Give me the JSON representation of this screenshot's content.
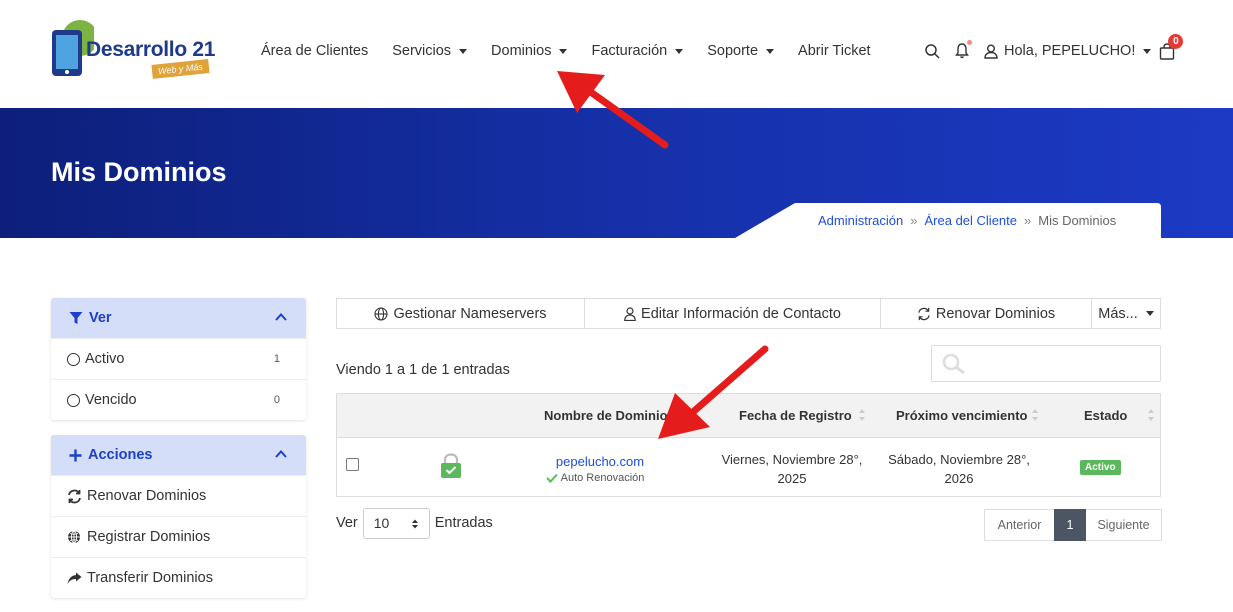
{
  "brand": {
    "name": "Desarrollo 21",
    "tagline": "Web y Más"
  },
  "nav": {
    "items": [
      {
        "label": "Área de Clientes",
        "dropdown": false
      },
      {
        "label": "Servicios",
        "dropdown": true
      },
      {
        "label": "Dominios",
        "dropdown": true
      },
      {
        "label": "Facturación",
        "dropdown": true
      },
      {
        "label": "Soporte",
        "dropdown": true
      },
      {
        "label": "Abrir Ticket",
        "dropdown": false
      }
    ],
    "greeting": "Hola, PEPELUCHO!",
    "cart_count": "0"
  },
  "banner": {
    "title": "Mis Dominios",
    "breadcrumb": [
      "Administración",
      "Área del Cliente",
      "Mis Dominios"
    ]
  },
  "sidebar": {
    "view": {
      "title": "Ver",
      "items": [
        {
          "label": "Activo",
          "count": "1"
        },
        {
          "label": "Vencido",
          "count": "0"
        }
      ]
    },
    "actions": {
      "title": "Acciones",
      "items": [
        {
          "label": "Renovar Dominios",
          "icon": "refresh-icon"
        },
        {
          "label": "Registrar Dominios",
          "icon": "globe-icon"
        },
        {
          "label": "Transferir Dominios",
          "icon": "share-icon"
        }
      ]
    }
  },
  "toolbar": {
    "nameservers": "Gestionar Nameservers",
    "contact": "Editar Información de Contacto",
    "renew": "Renovar Dominios",
    "more": "Más..."
  },
  "table": {
    "info": "Viendo 1 a 1 de 1 entradas",
    "columns": [
      "Nombre de Dominio",
      "Fecha de Registro",
      "Próximo vencimiento",
      "Estado"
    ],
    "rows": [
      {
        "domain": "pepelucho.com",
        "auto_renew": "Auto Renovación",
        "registered_line1": "Viernes, Noviembre 28°,",
        "registered_line2": "2025",
        "expires_line1": "Sábado, Noviembre 28°,",
        "expires_line2": "2026",
        "status": "Activo"
      }
    ]
  },
  "footer_controls": {
    "show_label": "Ver",
    "page_size": "10",
    "entries_label": "Entradas",
    "prev": "Anterior",
    "current_page": "1",
    "next": "Siguiente"
  },
  "colors": {
    "accent": "#1d3fc9",
    "banner_start": "#0d1f7a",
    "banner_end": "#1c3ac4",
    "status_active": "#5cb85c",
    "annotation_arrow": "#e51c1c"
  }
}
